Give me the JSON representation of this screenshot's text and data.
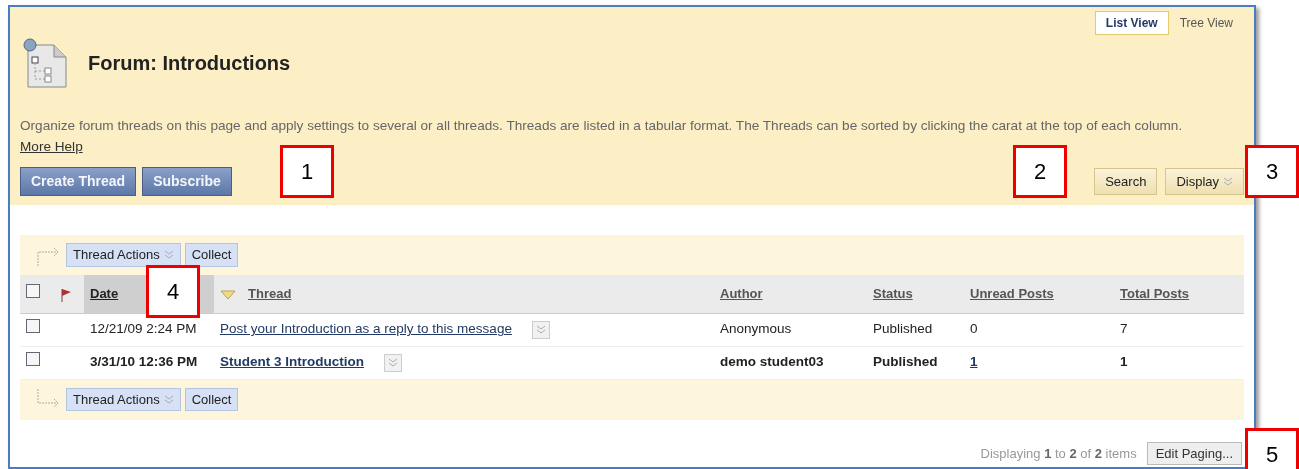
{
  "view_tabs": [
    {
      "label": "List View",
      "selected": true
    },
    {
      "label": "Tree View",
      "selected": false
    }
  ],
  "title": "Forum: Introductions",
  "description": "Organize forum threads on this page and apply settings to several or all threads. Threads are listed in a tabular format. The Threads can be sorted by clicking the carat at the top of each column.",
  "help_link": "More Help",
  "primary_buttons": [
    "Create Thread",
    "Subscribe"
  ],
  "secondary_buttons": [
    {
      "label": "Search",
      "kind": "plain"
    },
    {
      "label": "Display",
      "kind": "menu"
    }
  ],
  "action_bar_top": [
    {
      "label": "Thread Actions",
      "kind": "menu"
    },
    {
      "label": "Collect",
      "kind": "plain"
    }
  ],
  "select_all": {
    "checked": false
  },
  "columns": [
    {
      "label": "Date",
      "sorted": true
    },
    {
      "label": "Thread",
      "sorted": false
    },
    {
      "label": "Author",
      "sorted": false
    },
    {
      "label": "Status",
      "sorted": false
    },
    {
      "label": "Unread Posts",
      "sorted": false
    },
    {
      "label": "Total Posts",
      "sorted": false
    }
  ],
  "rows": [
    {
      "checked": false,
      "unread": false,
      "date": "12/21/09 2:24 PM",
      "thread": "Post your Introduction as a reply to this message",
      "author": "Anonymous",
      "status": "Published",
      "unread_posts": "0",
      "unread_link": false,
      "total_posts": "7"
    },
    {
      "checked": false,
      "unread": true,
      "date": "3/31/10 12:36 PM",
      "thread": "Student 3 Introduction",
      "author": "demo student03",
      "status": "Published",
      "unread_posts": "1",
      "unread_link": true,
      "total_posts": "1"
    }
  ],
  "action_bar_bottom": [
    {
      "label": "Thread Actions",
      "kind": "menu"
    },
    {
      "label": "Collect",
      "kind": "plain"
    }
  ],
  "paging": {
    "summary": "Displaying **1** to **2** of **2** items",
    "button": "Edit Paging..."
  },
  "callouts": [
    "1",
    "2",
    "3",
    "4",
    "5"
  ]
}
